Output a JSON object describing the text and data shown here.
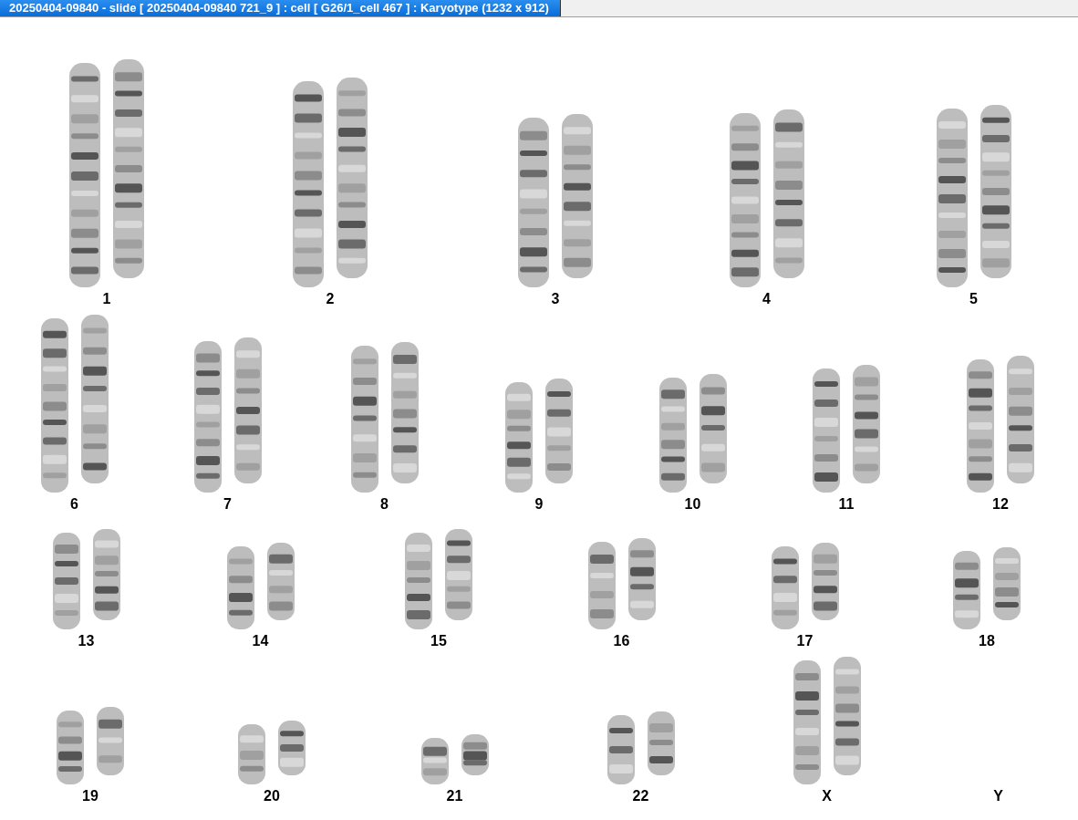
{
  "window": {
    "title": "20250404-09840 - slide [ 20250404-09840 721_9 ] : cell [ G26/1_cell 467 ] : Karyotype  (1232 x 912)"
  },
  "rows": [
    [
      {
        "label": "1",
        "kind": "pair"
      },
      {
        "label": "2",
        "kind": "pair"
      },
      {
        "label": "3",
        "kind": "pair"
      },
      {
        "label": "4",
        "kind": "pair"
      },
      {
        "label": "5",
        "kind": "pair"
      }
    ],
    [
      {
        "label": "6",
        "kind": "pair"
      },
      {
        "label": "7",
        "kind": "pair"
      },
      {
        "label": "8",
        "kind": "pair"
      },
      {
        "label": "9",
        "kind": "pair"
      },
      {
        "label": "10",
        "kind": "pair"
      },
      {
        "label": "11",
        "kind": "pair"
      },
      {
        "label": "12",
        "kind": "pair"
      }
    ],
    [
      {
        "label": "13",
        "kind": "pair"
      },
      {
        "label": "14",
        "kind": "pair"
      },
      {
        "label": "15",
        "kind": "pair"
      },
      {
        "label": "16",
        "kind": "pair"
      },
      {
        "label": "17",
        "kind": "pair"
      },
      {
        "label": "18",
        "kind": "pair"
      }
    ],
    [
      {
        "label": "19",
        "kind": "pair"
      },
      {
        "label": "20",
        "kind": "pair"
      },
      {
        "label": "21",
        "kind": "pair"
      },
      {
        "label": "22",
        "kind": "pair"
      },
      {
        "label": "X",
        "kind": "pair"
      },
      {
        "label": "Y",
        "kind": "empty"
      }
    ]
  ]
}
